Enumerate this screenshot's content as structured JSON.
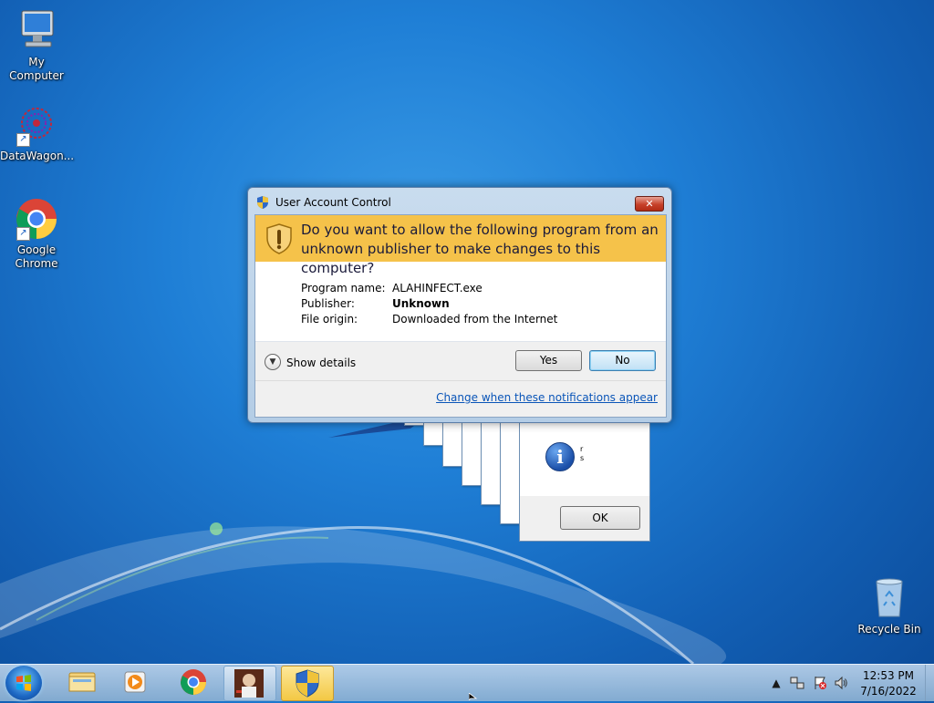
{
  "desktop": {
    "icons": [
      {
        "label": "My Computer",
        "icon": "computer-icon"
      },
      {
        "label": "DataWagon...",
        "icon": "datawagon-icon"
      },
      {
        "label": "Google Chrome",
        "icon": "chrome-icon"
      },
      {
        "label": "Recycle Bin",
        "icon": "recycle-bin-icon"
      }
    ]
  },
  "message_box": {
    "text_line1": "r",
    "text_line2": "s",
    "ok_label": "OK",
    "icon": "info-icon"
  },
  "uac": {
    "title": "User Account Control",
    "close_label": "✕",
    "question": "Do you want to allow the following program from an unknown publisher to make changes to this computer?",
    "fields": [
      {
        "label": "Program name:",
        "value": "ALAHINFECT.exe"
      },
      {
        "label": "Publisher:",
        "value": "Unknown"
      },
      {
        "label": "File origin:",
        "value": "Downloaded from the Internet"
      }
    ],
    "show_details": "Show details",
    "yes_label": "Yes",
    "no_label": "No",
    "link": "Change when these notifications appear",
    "colors": {
      "banner": "#f5c24a",
      "link": "#0a55b8"
    }
  },
  "taskbar": {
    "pinned": [
      "start-orb",
      "explorer-icon",
      "media-player-icon",
      "chrome-icon",
      "alahinfect-app-icon",
      "uac-shield-icon"
    ],
    "clock_time": "12:53 PM",
    "clock_date": "7/16/2022",
    "tray_icons": [
      "show-hidden-icons",
      "network-icon",
      "action-center-icon",
      "volume-icon"
    ]
  }
}
